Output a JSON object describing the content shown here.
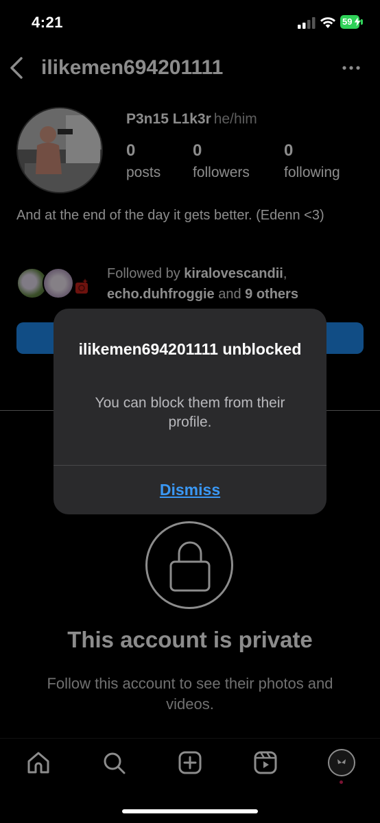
{
  "status_bar": {
    "time": "4:21",
    "battery": "59"
  },
  "profile": {
    "username": "ilikemen694201111",
    "display_name": "P3n15 L1k3r",
    "pronouns": "he/him",
    "stats": [
      {
        "value": "0",
        "label": "posts"
      },
      {
        "value": "0",
        "label": "followers"
      },
      {
        "value": "0",
        "label": "following"
      }
    ],
    "bio": "And at the end of the day it gets better. (Edenn <3)",
    "followed_by": {
      "prefix": "Followed by ",
      "user1": "kiralovescandii",
      "sep": ",",
      "user2": "echo.duhfroggie",
      "and": " and ",
      "others": "9 others"
    }
  },
  "private": {
    "title": "This account is private",
    "subtitle": "Follow this account to see their photos and videos."
  },
  "alert": {
    "title": "ilikemen694201111 unblocked",
    "message": "You can block them from their profile.",
    "button": "Dismiss"
  },
  "bottom_nav": [
    "home-icon",
    "search-icon",
    "create-icon",
    "reels-icon",
    "profile-icon"
  ],
  "colors": {
    "accent": "#1f8cf2",
    "link": "#3a98f5",
    "battery": "#2fd158",
    "notification": "#e0245e"
  }
}
